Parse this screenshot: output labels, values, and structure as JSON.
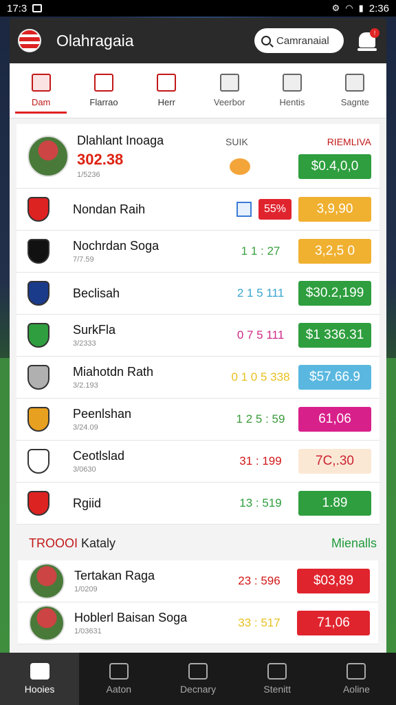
{
  "status_bar": {
    "time_left": "17:3",
    "time_right": "2:36"
  },
  "app": {
    "title": "Olahragaia"
  },
  "search": {
    "value": "Camranaial"
  },
  "notifications": {
    "count": "!"
  },
  "tabs": [
    {
      "label": "Dam",
      "icon": "team-icon",
      "state": "active"
    },
    {
      "label": "Flarrao",
      "icon": "flag-icon",
      "state": "red"
    },
    {
      "label": "Herr",
      "icon": "book-icon",
      "state": "red"
    },
    {
      "label": "Veerbor",
      "icon": "board-icon",
      "state": "normal"
    },
    {
      "label": "Hentis",
      "icon": "shirt-icon",
      "state": "normal"
    },
    {
      "label": "Sagnte",
      "icon": "badge-icon",
      "state": "normal"
    }
  ],
  "featured": {
    "name": "Dlahlant Inoaga",
    "score": "302.38",
    "sub": "1/5236",
    "mid_label": "SUIK",
    "right_label": "RIEMLIVA",
    "value": "$0.4,0,0"
  },
  "rows": [
    {
      "name": "Nondan Raih",
      "sub": "",
      "chip": "55%",
      "value": "3,9,90",
      "color": "#f0b030"
    },
    {
      "name": "Nochrdan Soga",
      "sub": "7/7.59",
      "mid": "1 1 : 27",
      "mid_color": "#3aa040",
      "value": "3,2,5 0",
      "color": "#f0b030"
    },
    {
      "name": "Beclisah",
      "sub": "",
      "mid": "2 1 5 111",
      "mid_color": "#3aa5d0",
      "value": "$30.2,199",
      "color": "#2e9e3e"
    },
    {
      "name": "SurkFla",
      "sub": "3/2333",
      "mid": "0 7 5 111",
      "mid_color": "#d02a8a",
      "value": "$1 336.31",
      "color": "#2e9e3e"
    },
    {
      "name": "Miahotdn Rath",
      "sub": "3/2.193",
      "mid": "0 1 0 5 338",
      "mid_color": "#e8c020",
      "value": "$57.66.9",
      "color": "#5ab8e0"
    },
    {
      "name": "Peenlshan",
      "sub": "3/24.09",
      "mid": "1 2 5 : 59",
      "mid_color": "#3a9a3a",
      "value": "61,06",
      "color": "#d8208a"
    },
    {
      "name": "Ceotlslad",
      "sub": "3/0630",
      "mid": "31 : 199",
      "mid_color": "#d21818",
      "value": "7C,.30",
      "color": "#fbe8d4",
      "text_color": "#c23"
    },
    {
      "name": "Rgiid",
      "sub": "",
      "mid": "13 : 519",
      "mid_color": "#2e9e3e",
      "value": "1.89",
      "color": "#2e9e3e"
    }
  ],
  "section": {
    "left_red": "TROOOI",
    "left": "Kataly",
    "right": "Mienalls"
  },
  "rows2": [
    {
      "name": "Tertakan Raga",
      "sub": "1/0209",
      "mid": "23 : 596",
      "mid_color": "#d21818",
      "value": "$03,89",
      "color": "#e0242e"
    },
    {
      "name": "Hoblerl Baisan Soga",
      "sub": "1/03631",
      "mid": "33 : 517",
      "mid_color": "#e8c020",
      "value": "71,06",
      "color": "#e0242e"
    }
  ],
  "bottom_nav": [
    {
      "label": "Hooies",
      "active": true
    },
    {
      "label": "Aaton",
      "active": false
    },
    {
      "label": "Decnary",
      "active": false
    },
    {
      "label": "Stenitt",
      "active": false
    },
    {
      "label": "Aoline",
      "active": false
    }
  ]
}
